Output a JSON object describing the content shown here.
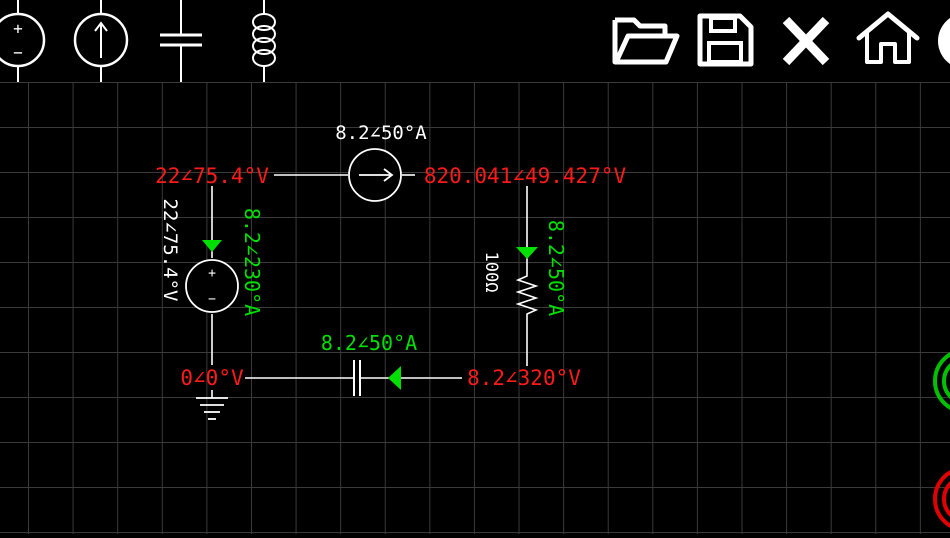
{
  "colors": {
    "background": "#000000",
    "grid": "#3a3a3a",
    "wire": "#ffffff",
    "voltage_label": "#ff1a1a",
    "current_label": "#00e000",
    "run_button": "#00c000",
    "stop_button": "#e00000"
  },
  "toolbar": {
    "components": [
      {
        "name": "ac-voltage-source-icon",
        "symbol_plus": "+",
        "symbol_minus": "−"
      },
      {
        "name": "current-source-icon"
      },
      {
        "name": "capacitor-icon"
      },
      {
        "name": "inductor-icon"
      }
    ],
    "actions": [
      {
        "name": "open-folder-icon"
      },
      {
        "name": "save-icon"
      },
      {
        "name": "close-icon"
      },
      {
        "name": "home-icon"
      }
    ]
  },
  "circuit": {
    "current_source_label": "8.2∠50°A",
    "top_left_node_voltage": "22∠75.4°V",
    "top_right_node_voltage": "820.041∠49.427°V",
    "voltage_source_label": "22∠75.4°V",
    "voltage_source_plus": "+",
    "voltage_source_minus": "−",
    "left_branch_current": "8.2∠230°A",
    "resistor_value": "100Ω",
    "right_branch_current": "8.2∠50°A",
    "bottom_left_node_voltage": "0∠0°V",
    "capacitor_current": "8.2∠50°A",
    "bottom_right_node_voltage": "8.2∠320°V"
  }
}
